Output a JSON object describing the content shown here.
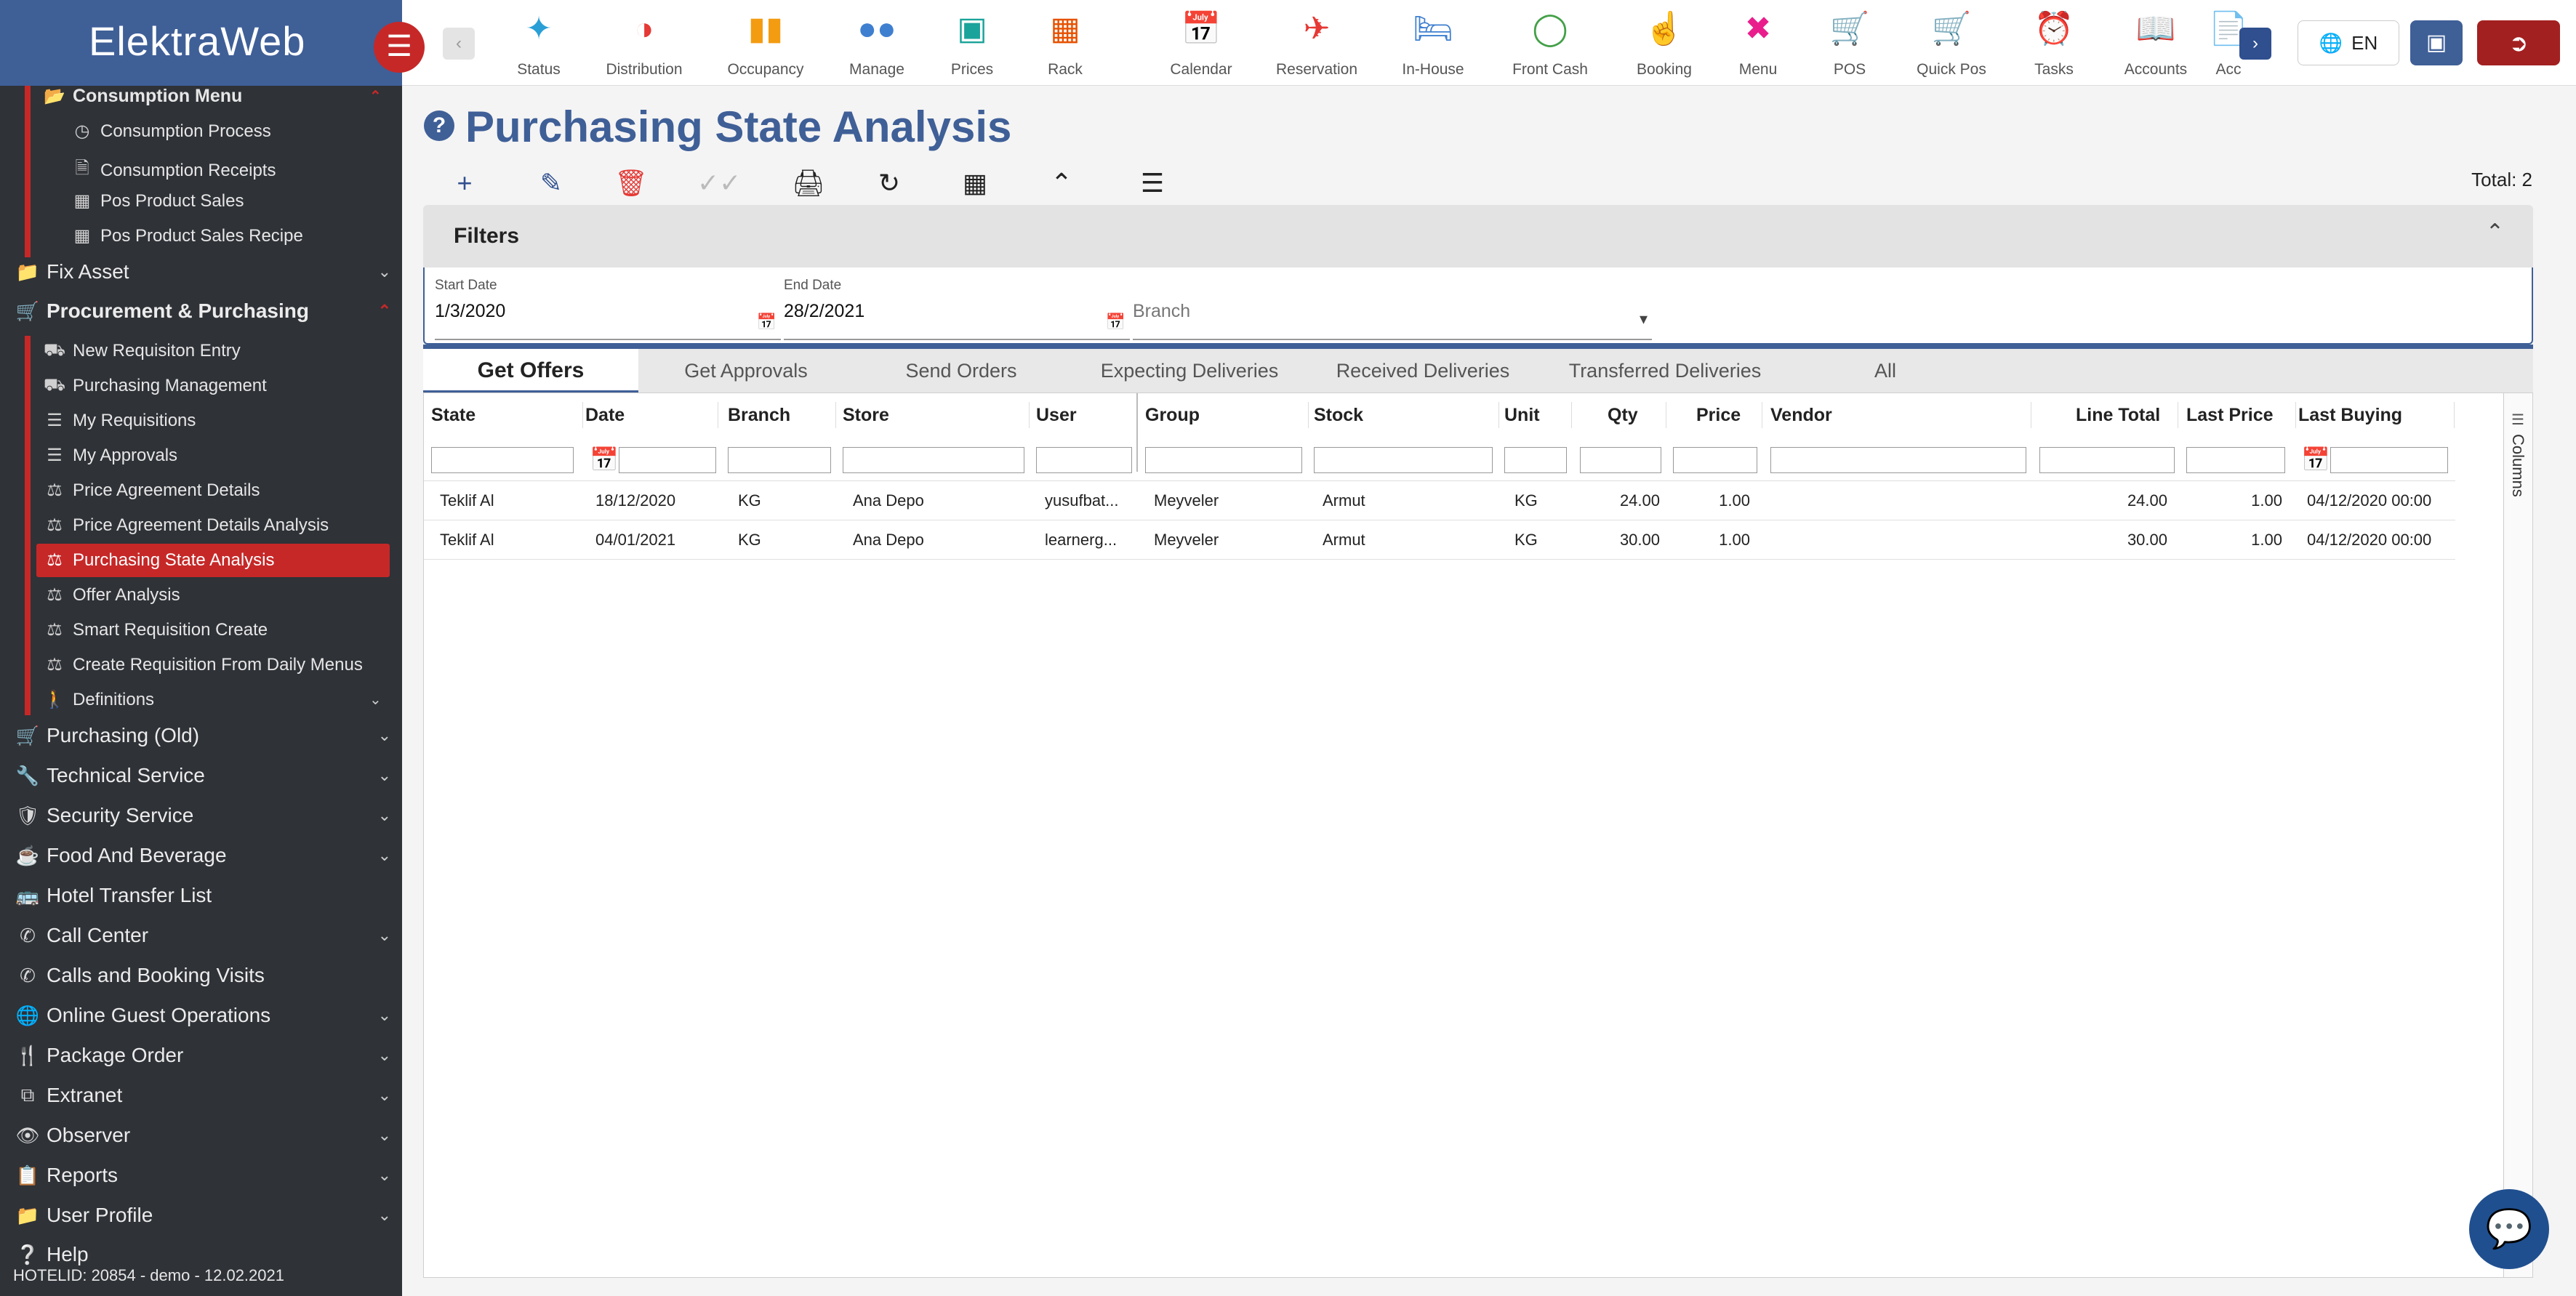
{
  "app": {
    "logo": "ElektraWeb",
    "footer": "HOTELID: 20854 - demo - 12.02.2021"
  },
  "topnav": {
    "items": [
      {
        "label": "Status",
        "icon": "wifi-icon",
        "color": "#2a9fd6"
      },
      {
        "label": "Distribution",
        "icon": "pie-chart-icon",
        "color": "#e53935"
      },
      {
        "label": "Occupancy",
        "icon": "bar-chart-icon",
        "color": "#f39c12"
      },
      {
        "label": "Manage",
        "icon": "users-icon",
        "color": "#3f7fd0"
      },
      {
        "label": "Prices",
        "icon": "price-board-icon",
        "color": "#1aa39a"
      },
      {
        "label": "Rack",
        "icon": "grid-icon",
        "color": "#e65100"
      },
      {
        "label": "Calendar",
        "icon": "calendar-icon",
        "color": "#673ab7"
      },
      {
        "label": "Reservation",
        "icon": "plane-landing-icon",
        "color": "#e53935"
      },
      {
        "label": "In-House",
        "icon": "bed-icon",
        "color": "#3f7fd0"
      },
      {
        "label": "Front Cash",
        "icon": "dollar-icon",
        "color": "#43a047"
      },
      {
        "label": "Booking",
        "icon": "touch-icon",
        "color": "#e91e8c"
      },
      {
        "label": "Menu",
        "icon": "fork-knife-icon",
        "color": "#e91e8c"
      },
      {
        "label": "POS",
        "icon": "cart-plus-icon",
        "color": "#e65100"
      },
      {
        "label": "Quick Pos",
        "icon": "cart-icon",
        "color": "#9c27b0"
      },
      {
        "label": "Tasks",
        "icon": "alarm-icon",
        "color": "#e65100"
      },
      {
        "label": "Accounts",
        "icon": "book-icon",
        "color": "#1aa39a"
      },
      {
        "label": "Acc",
        "icon": "document-icon",
        "color": "#e53935"
      }
    ],
    "lang": "EN"
  },
  "sidebar": {
    "consumption_menu": "Consumption Menu",
    "consumption_items": [
      {
        "label": "Consumption Process",
        "icon": "clock-icon"
      },
      {
        "label": "Consumption Receipts",
        "icon": "receipt-icon"
      },
      {
        "label": "Pos Product Sales",
        "icon": "table-icon"
      },
      {
        "label": "Pos Product Sales Recipe",
        "icon": "table-icon"
      }
    ],
    "fix_asset": "Fix Asset",
    "procurement": "Procurement & Purchasing",
    "procurement_items": [
      {
        "label": "New Requisiton Entry",
        "icon": "truck-icon"
      },
      {
        "label": "Purchasing Management",
        "icon": "truck-icon"
      },
      {
        "label": "My Requisitions",
        "icon": "list-check-icon"
      },
      {
        "label": "My Approvals",
        "icon": "list-check-icon"
      },
      {
        "label": "Price Agreement Details",
        "icon": "analysis-icon"
      },
      {
        "label": "Price Agreement Details Analysis",
        "icon": "analysis-icon"
      },
      {
        "label": "Purchasing State Analysis",
        "icon": "analysis-icon"
      },
      {
        "label": "Offer Analysis",
        "icon": "analysis-icon"
      },
      {
        "label": "Smart Requisition Create",
        "icon": "analysis-icon"
      },
      {
        "label": "Create Requisition From Daily Menus",
        "icon": "analysis-icon"
      },
      {
        "label": "Definitions",
        "icon": "walker-icon"
      }
    ],
    "main_items": [
      {
        "label": "Purchasing (Old)",
        "icon": "cart-icon"
      },
      {
        "label": "Technical Service",
        "icon": "wrench-icon"
      },
      {
        "label": "Security Service",
        "icon": "shield-icon"
      },
      {
        "label": "Food And Beverage",
        "icon": "coffee-icon"
      },
      {
        "label": "Hotel Transfer List",
        "icon": "bus-icon"
      },
      {
        "label": "Call Center",
        "icon": "phone-icon"
      },
      {
        "label": "Calls and Booking Visits",
        "icon": "phone-icon"
      },
      {
        "label": "Online Guest Operations",
        "icon": "globe-icon"
      },
      {
        "label": "Package Order",
        "icon": "fork-knife-icon"
      },
      {
        "label": "Extranet",
        "icon": "external-icon"
      },
      {
        "label": "Observer",
        "icon": "eye-icon"
      },
      {
        "label": "Reports",
        "icon": "report-icon"
      },
      {
        "label": "User Profile",
        "icon": "folder-icon"
      },
      {
        "label": "Help",
        "icon": "help-icon"
      }
    ]
  },
  "page": {
    "title": "Purchasing State Analysis",
    "total": "Total: 2"
  },
  "filters": {
    "title": "Filters",
    "start_label": "Start Date",
    "start_value": "1/3/2020",
    "end_label": "End Date",
    "end_value": "28/2/2021",
    "branch_placeholder": "Branch"
  },
  "tabs": [
    "Get Offers",
    "Get Approvals",
    "Send Orders",
    "Expecting Deliveries",
    "Received Deliveries",
    "Transferred Deliveries",
    "All"
  ],
  "grid": {
    "columns_label": "Columns",
    "headers": [
      "State",
      "Date",
      "Branch",
      "Store",
      "User",
      "Group",
      "Stock",
      "Unit",
      "Qty",
      "Price",
      "Vendor",
      "Line Total",
      "Last Price",
      "Last Buying"
    ],
    "rows": [
      [
        "Teklif Al",
        "18/12/2020",
        "KG",
        "Ana Depo",
        "yusufbat...",
        "Meyveler",
        "Armut",
        "KG",
        "24.00",
        "1.00",
        "",
        "24.00",
        "1.00",
        "04/12/2020 00:00"
      ],
      [
        "Teklif Al",
        "04/01/2021",
        "KG",
        "Ana Depo",
        "learnerg...",
        "Meyveler",
        "Armut",
        "KG",
        "30.00",
        "1.00",
        "",
        "30.00",
        "1.00",
        "04/12/2020 00:00"
      ]
    ]
  },
  "colors": {
    "brand": "#3f5f97",
    "accent": "#c62828",
    "sidebar_bg": "#2f3237"
  }
}
